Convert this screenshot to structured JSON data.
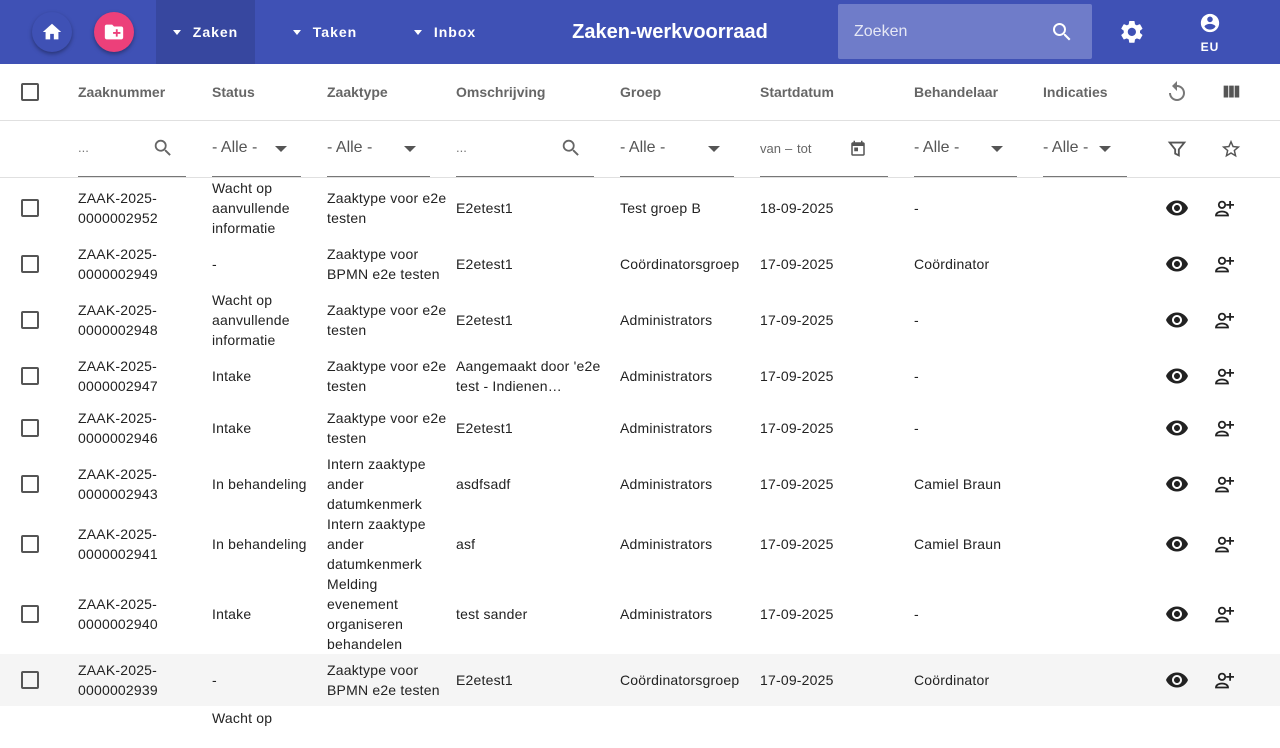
{
  "topbar": {
    "menus": [
      {
        "label": "Zaken"
      },
      {
        "label": "Taken"
      },
      {
        "label": "Inbox"
      }
    ],
    "title": "Zaken-werkvoorraad",
    "search_placeholder": "Zoeken",
    "user_label": "EU",
    "colors": {
      "primary": "#3f51b5",
      "accent": "#ec407a"
    }
  },
  "table": {
    "columns": [
      "Zaaknummer",
      "Status",
      "Zaaktype",
      "Omschrijving",
      "Groep",
      "Startdatum",
      "Behandelaar",
      "Indicaties"
    ],
    "filters": {
      "zaaknummer_placeholder": "...",
      "omschrijving_placeholder": "...",
      "all_label": "- Alle -",
      "date_from": "van",
      "date_separator": "–",
      "date_to": "tot"
    },
    "rows": [
      {
        "nr": [
          "ZAAK-2025-",
          "0000002952"
        ],
        "status": [
          "Wacht op",
          "aanvullende",
          "informatie"
        ],
        "type": [
          "Zaaktype voor e2e",
          "testen"
        ],
        "desc": [
          "E2etest1"
        ],
        "groep": "Test groep B",
        "start": "18-09-2025",
        "behandelaar": "-"
      },
      {
        "nr": [
          "ZAAK-2025-",
          "0000002949"
        ],
        "status": [
          "-"
        ],
        "type": [
          "Zaaktype voor",
          "BPMN e2e testen"
        ],
        "desc": [
          "E2etest1"
        ],
        "groep": "Coördinatorsgroep",
        "start": "17-09-2025",
        "behandelaar": "Coördinator"
      },
      {
        "nr": [
          "ZAAK-2025-",
          "0000002948"
        ],
        "status": [
          "Wacht op",
          "aanvullende",
          "informatie"
        ],
        "type": [
          "Zaaktype voor e2e",
          "testen"
        ],
        "desc": [
          "E2etest1"
        ],
        "groep": "Administrators",
        "start": "17-09-2025",
        "behandelaar": "-"
      },
      {
        "nr": [
          "ZAAK-2025-",
          "0000002947"
        ],
        "status": [
          "Intake"
        ],
        "type": [
          "Zaaktype voor e2e",
          "testen"
        ],
        "desc": [
          "Aangemaakt door 'e2e",
          "test - Indienen…"
        ],
        "groep": "Administrators",
        "start": "17-09-2025",
        "behandelaar": "-"
      },
      {
        "nr": [
          "ZAAK-2025-",
          "0000002946"
        ],
        "status": [
          "Intake"
        ],
        "type": [
          "Zaaktype voor e2e",
          "testen"
        ],
        "desc": [
          "E2etest1"
        ],
        "groep": "Administrators",
        "start": "17-09-2025",
        "behandelaar": "-"
      },
      {
        "nr": [
          "ZAAK-2025-",
          "0000002943"
        ],
        "status": [
          "In behandeling"
        ],
        "type": [
          "Intern zaaktype",
          "ander",
          "datumkenmerk"
        ],
        "desc": [
          "asdfsadf"
        ],
        "groep": "Administrators",
        "start": "17-09-2025",
        "behandelaar": "Camiel Braun"
      },
      {
        "nr": [
          "ZAAK-2025-",
          "0000002941"
        ],
        "status": [
          "In behandeling"
        ],
        "type": [
          "Intern zaaktype",
          "ander",
          "datumkenmerk"
        ],
        "desc": [
          "asf"
        ],
        "groep": "Administrators",
        "start": "17-09-2025",
        "behandelaar": "Camiel Braun"
      },
      {
        "nr": [
          "ZAAK-2025-",
          "0000002940"
        ],
        "status": [
          "Intake"
        ],
        "type": [
          "Melding",
          "evenement",
          "organiseren",
          "behandelen"
        ],
        "desc": [
          "test sander"
        ],
        "groep": "Administrators",
        "start": "17-09-2025",
        "behandelaar": "-"
      },
      {
        "nr": [
          "ZAAK-2025-",
          "0000002939"
        ],
        "status": [
          "-"
        ],
        "type": [
          "Zaaktype voor",
          "BPMN e2e testen"
        ],
        "desc": [
          "E2etest1"
        ],
        "groep": "Coördinatorsgroep",
        "start": "17-09-2025",
        "behandelaar": "Coördinator"
      },
      {
        "nr": [],
        "status": [
          "Wacht op"
        ],
        "type": [],
        "desc": [],
        "groep": "",
        "start": "",
        "behandelaar": ""
      }
    ]
  }
}
